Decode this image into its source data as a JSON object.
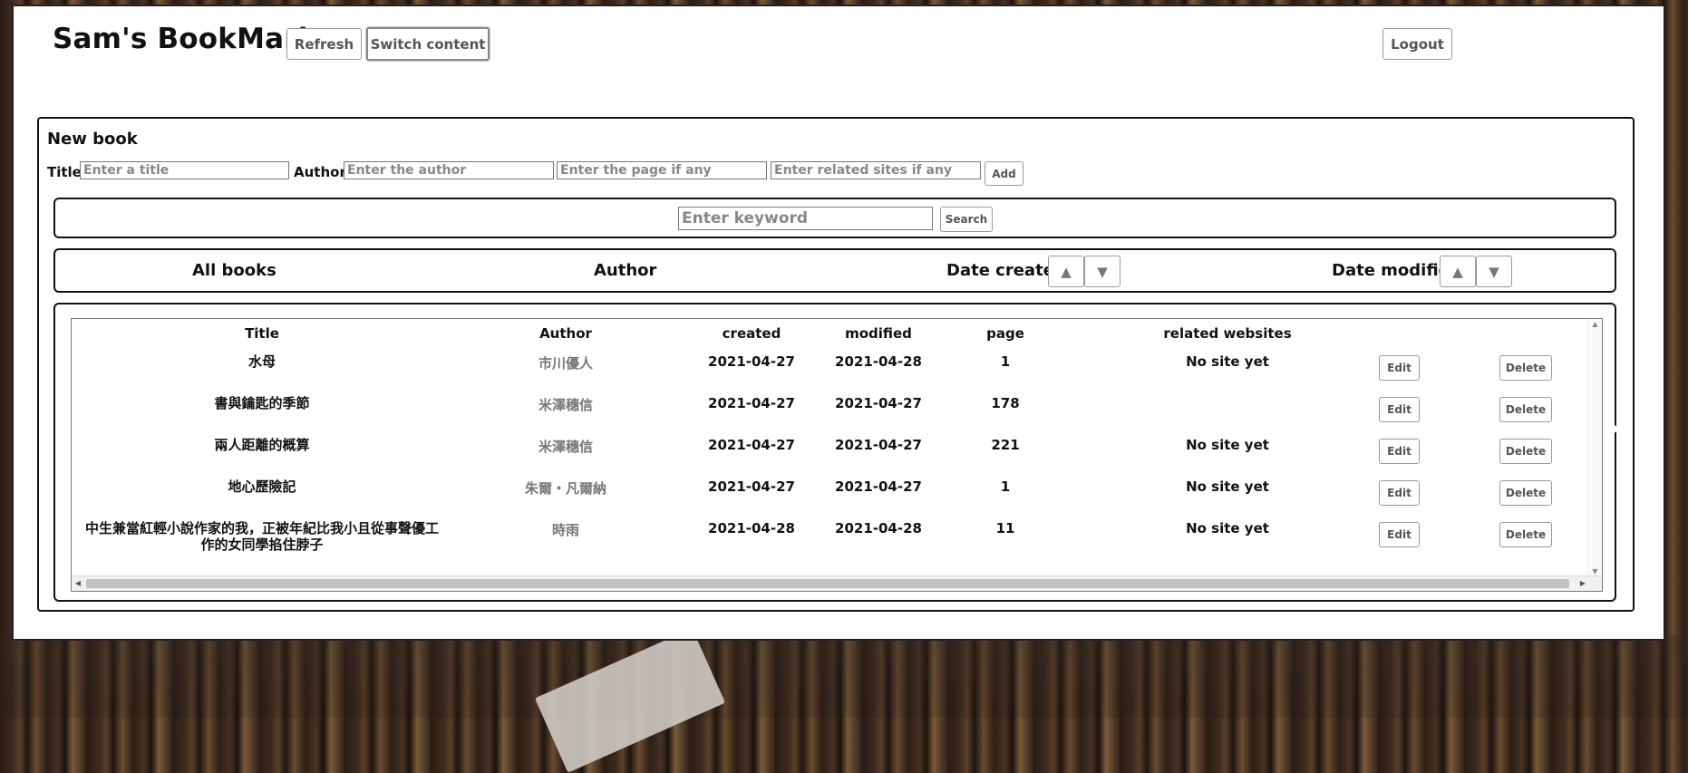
{
  "header": {
    "title": "Sam's BookMark",
    "refresh_label": "Refresh",
    "switch_label": "Switch content",
    "logout_label": "Logout"
  },
  "new_book": {
    "heading": "New book",
    "title_label": "Title",
    "title_placeholder": "Enter a title",
    "author_label": "Author",
    "author_placeholder": "Enter the author",
    "page_placeholder": "Enter the page if any",
    "sites_placeholder": "Enter related sites if any",
    "add_label": "Add"
  },
  "search": {
    "placeholder": "Enter keyword",
    "button_label": "Search"
  },
  "sort": {
    "all_books": "All books",
    "author": "Author",
    "date_created": "Date created",
    "date_modified": "Date modified",
    "up_arrow": "▲",
    "down_arrow": "▼"
  },
  "table": {
    "columns": [
      "Title",
      "Author",
      "created",
      "modified",
      "page",
      "related websites"
    ],
    "edit_label": "Edit",
    "delete_label": "Delete",
    "rows": [
      {
        "title": "水母",
        "author": "市川優人",
        "created": "2021-04-27",
        "modified": "2021-04-28",
        "page": "1",
        "sites": "No site yet"
      },
      {
        "title": "書與鑰匙的季節",
        "author": "米澤穗信",
        "created": "2021-04-27",
        "modified": "2021-04-27",
        "page": "178",
        "sites": ""
      },
      {
        "title": "兩人距離的概算",
        "author": "米澤穗信",
        "created": "2021-04-27",
        "modified": "2021-04-27",
        "page": "221",
        "sites": "No site yet"
      },
      {
        "title": "地心歷險記",
        "author": "朱爾・凡爾納",
        "created": "2021-04-27",
        "modified": "2021-04-27",
        "page": "1",
        "sites": "No site yet"
      },
      {
        "title": "中生兼當紅輕小說作家的我，正被年紀比我小且從事聲優工作的女同學掐住脖子",
        "author": "時雨",
        "created": "2021-04-28",
        "modified": "2021-04-28",
        "page": "11",
        "sites": "No site yet"
      }
    ]
  },
  "icons": {
    "scroll_up": "▲",
    "scroll_down": "▼",
    "scroll_left": "◀",
    "scroll_right": "▶"
  }
}
